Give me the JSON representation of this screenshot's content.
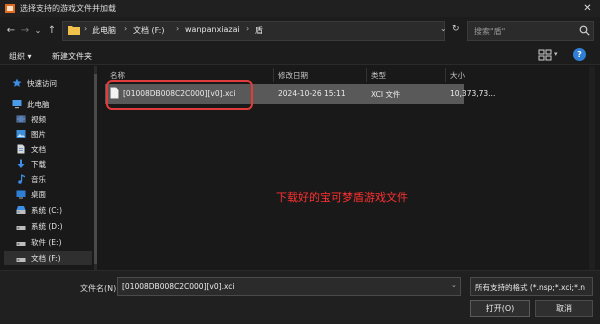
{
  "window": {
    "title": "选择支持的游戏文件并加载",
    "close_icon": "✕"
  },
  "nav": {
    "back_icon": "←",
    "forward_icon": "→",
    "dropdown_icon": "⌄",
    "up_icon": "↑",
    "breadcrumb": [
      "此电脑",
      "文档 (F:)",
      "wanpanxiazai",
      "盾"
    ],
    "separator": "›",
    "address_dropdown_icon": "⌄",
    "refresh_icon": "↻",
    "search_placeholder": "搜索\"盾\""
  },
  "toolbar": {
    "organize_label": "组织 ▾",
    "new_folder_label": "新建文件夹",
    "view_dropdown_icon": "▾",
    "help_icon": "?"
  },
  "sidebar": {
    "items": [
      {
        "label": "快速访问",
        "icon": "star-icon"
      },
      {
        "label": "此电脑",
        "icon": "computer-icon"
      },
      {
        "label": "视频",
        "icon": "video-icon"
      },
      {
        "label": "图片",
        "icon": "picture-icon"
      },
      {
        "label": "文档",
        "icon": "document-icon"
      },
      {
        "label": "下载",
        "icon": "download-icon"
      },
      {
        "label": "音乐",
        "icon": "music-icon"
      },
      {
        "label": "桌面",
        "icon": "desktop-icon"
      },
      {
        "label": "系统 (C:)",
        "icon": "drive-icon"
      },
      {
        "label": "系统 (D:)",
        "icon": "drive-icon"
      },
      {
        "label": "软件 (E:)",
        "icon": "drive-icon"
      },
      {
        "label": "文档 (F:)",
        "icon": "drive-icon",
        "selected": true
      }
    ]
  },
  "files": {
    "columns": [
      "名称",
      "修改日期",
      "类型",
      "大小"
    ],
    "rows": [
      {
        "name": "[01008DB008C2C000][v0].xci",
        "modified": "2024-10-26 15:11",
        "type": "XCI 文件",
        "size": "10,373,73..."
      }
    ]
  },
  "annotation": {
    "text": "下载好的宝可梦盾游戏文件",
    "color": "#ff3030"
  },
  "footer": {
    "filename_label": "文件名(N):",
    "filename_value": "[01008DB008C2C000][v0].xci",
    "filename_dropdown_icon": "⌄",
    "filetype_value": "所有支持的格式 (*.nsp;*.xci;*.n",
    "open_label": "打开(O)",
    "cancel_label": "取消"
  },
  "colors": {
    "highlight_border": "#e23b3b",
    "selected_row": "#595959",
    "accent": "#2f7fd6"
  }
}
